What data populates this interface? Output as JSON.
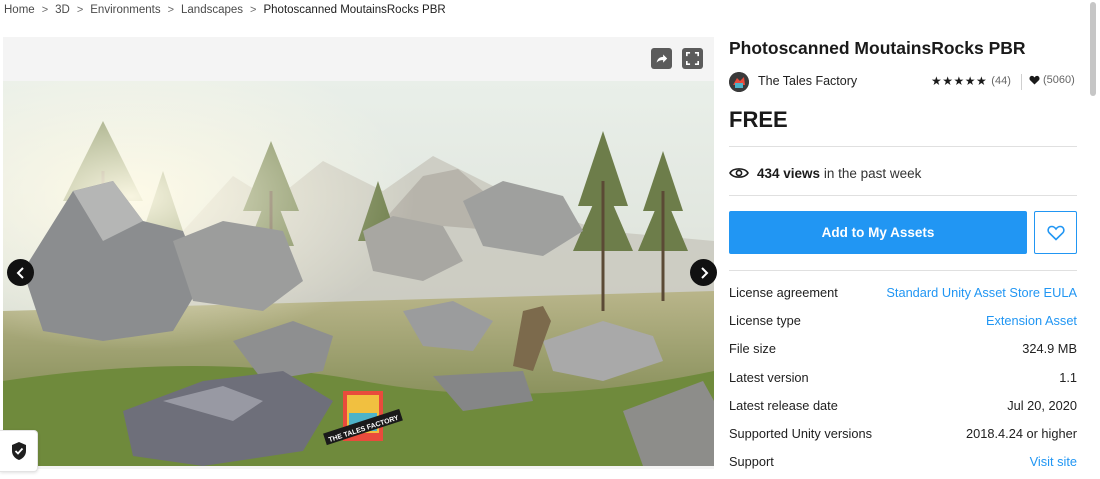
{
  "breadcrumb": {
    "items": [
      "Home",
      "3D",
      "Environments",
      "Landscapes",
      "Photoscanned MoutainsRocks PBR"
    ],
    "separator": ">"
  },
  "gallery": {
    "share_icon": "share-icon",
    "fullscreen_icon": "fullscreen-icon",
    "prev_icon": "chevron-left-icon",
    "next_icon": "chevron-right-icon",
    "watermark_text": "THE TALES FACTORY",
    "privacy_icon": "shield-check-icon"
  },
  "product": {
    "title": "Photoscanned MoutainsRocks PBR",
    "publisher": "The Tales Factory",
    "rating_stars": "★★★★★",
    "rating_count": "(44)",
    "favorites_count": "(5060)",
    "price": "FREE",
    "views_count": "434 views",
    "views_suffix": " in the past week",
    "add_button_label": "Add to My Assets"
  },
  "details": [
    {
      "label": "License agreement",
      "value": "Standard Unity Asset Store EULA",
      "link": true
    },
    {
      "label": "License type",
      "value": "Extension Asset",
      "link": true
    },
    {
      "label": "File size",
      "value": "324.9 MB",
      "link": false
    },
    {
      "label": "Latest version",
      "value": "1.1",
      "link": false
    },
    {
      "label": "Latest release date",
      "value": "Jul 20, 2020",
      "link": false
    },
    {
      "label": "Supported Unity versions",
      "value": "2018.4.24 or higher",
      "link": false
    },
    {
      "label": "Support",
      "value": "Visit site",
      "link": true
    }
  ],
  "colors": {
    "accent": "#2196f3",
    "text": "#212121",
    "gallery_bg": "#f4f4f4"
  }
}
